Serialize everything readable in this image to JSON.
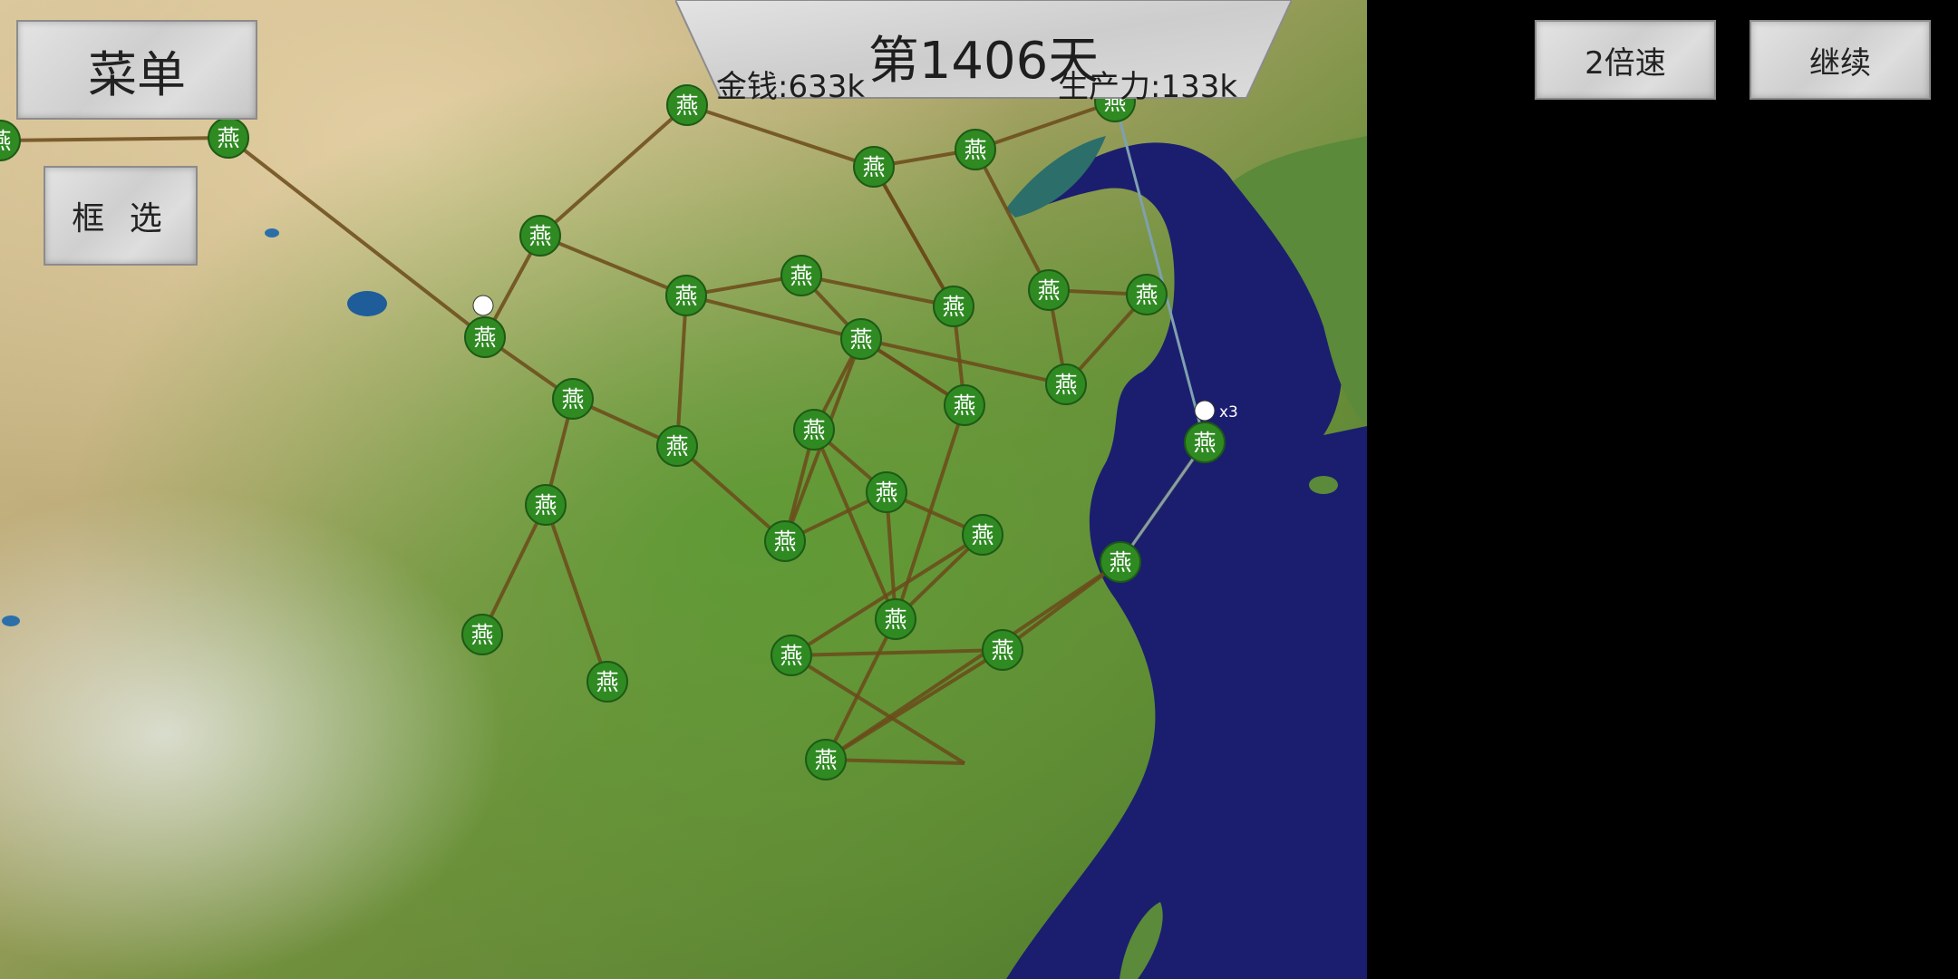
{
  "header": {
    "day": "第1406天",
    "money": "金钱:633k",
    "production": "生产力:133k"
  },
  "buttons": {
    "menu": "菜单",
    "box_select": "框 选",
    "speed": "2倍速",
    "continue": "继续"
  },
  "colors": {
    "faction_green": "#2f8a22",
    "road": "#6b4a1a",
    "sea_route": "#7fa0b0",
    "sea": "#1b1e6e"
  },
  "cities": [
    {
      "label": "燕"
    },
    {
      "label": "燕"
    },
    {
      "label": "燕"
    },
    {
      "label": "燕"
    },
    {
      "label": "燕"
    },
    {
      "label": "燕"
    },
    {
      "label": "燕"
    },
    {
      "label": "燕"
    },
    {
      "label": "燕"
    },
    {
      "label": "燕"
    },
    {
      "label": "燕"
    },
    {
      "label": "燕"
    },
    {
      "label": "燕"
    },
    {
      "label": "燕"
    },
    {
      "label": "燕"
    },
    {
      "label": "燕"
    },
    {
      "label": "燕"
    },
    {
      "label": "燕"
    },
    {
      "label": "燕"
    },
    {
      "label": "燕"
    },
    {
      "label": "燕"
    },
    {
      "label": "燕"
    },
    {
      "label": "燕"
    },
    {
      "label": "燕"
    },
    {
      "label": "燕"
    },
    {
      "label": "燕"
    },
    {
      "label": "燕"
    },
    {
      "label": "燕"
    },
    {
      "label": "燕"
    },
    {
      "label": "燕"
    },
    {
      "label": "燕"
    }
  ],
  "units": [
    {
      "count": "x3"
    }
  ]
}
